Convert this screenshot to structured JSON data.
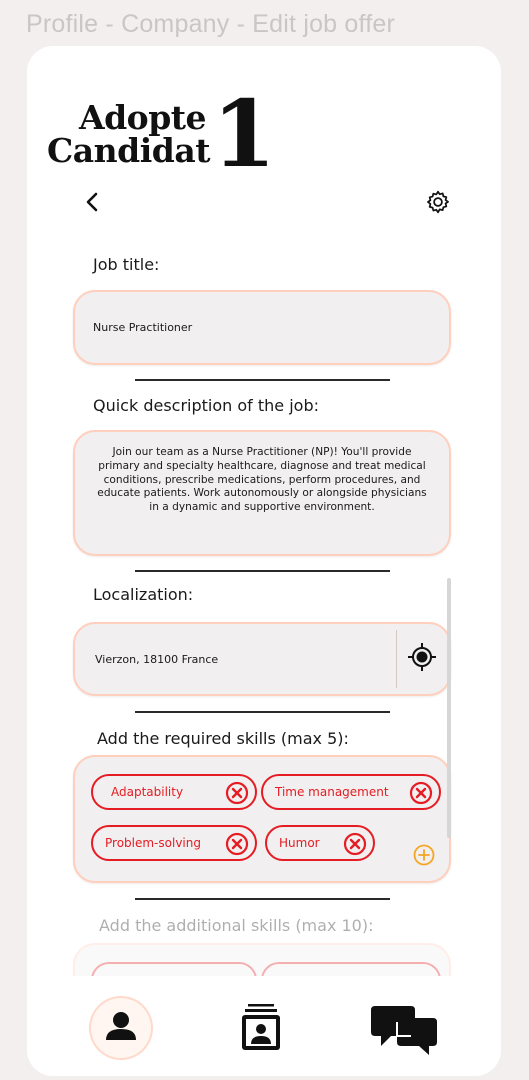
{
  "frame_title": "Profile - Company - Edit job offer",
  "logo": {
    "line1": "Adopte",
    "line2": "Candidat",
    "number": "1"
  },
  "job_title": {
    "label": "Job title:",
    "value": "Nurse Practitioner"
  },
  "description": {
    "label": "Quick description of the job:",
    "value": "Join our team as a Nurse Practitioner (NP)! You'll provide primary and specialty healthcare, diagnose and treat medical conditions, prescribe medications, perform procedures, and educate patients. Work autonomously or alongside physicians in a dynamic and supportive environment."
  },
  "localization": {
    "label": "Localization:",
    "value": "Vierzon, 18100 France"
  },
  "required_skills": {
    "label": "Add the required skills (max 5):",
    "items": [
      "Adaptability",
      "Time management",
      "Problem-solving",
      "Humor"
    ]
  },
  "additional_skills": {
    "label": "Add the additional skills (max 10):"
  },
  "colors": {
    "accent": "#ffcfbd",
    "chip": "#e51c23",
    "add": "#f5a623",
    "field_bg": "#f1efef"
  },
  "icons": [
    "back-icon",
    "gear-icon",
    "location-target-icon",
    "remove-skill-icon",
    "add-skill-icon",
    "profile-icon",
    "job-cards-icon",
    "chat-icon"
  ]
}
